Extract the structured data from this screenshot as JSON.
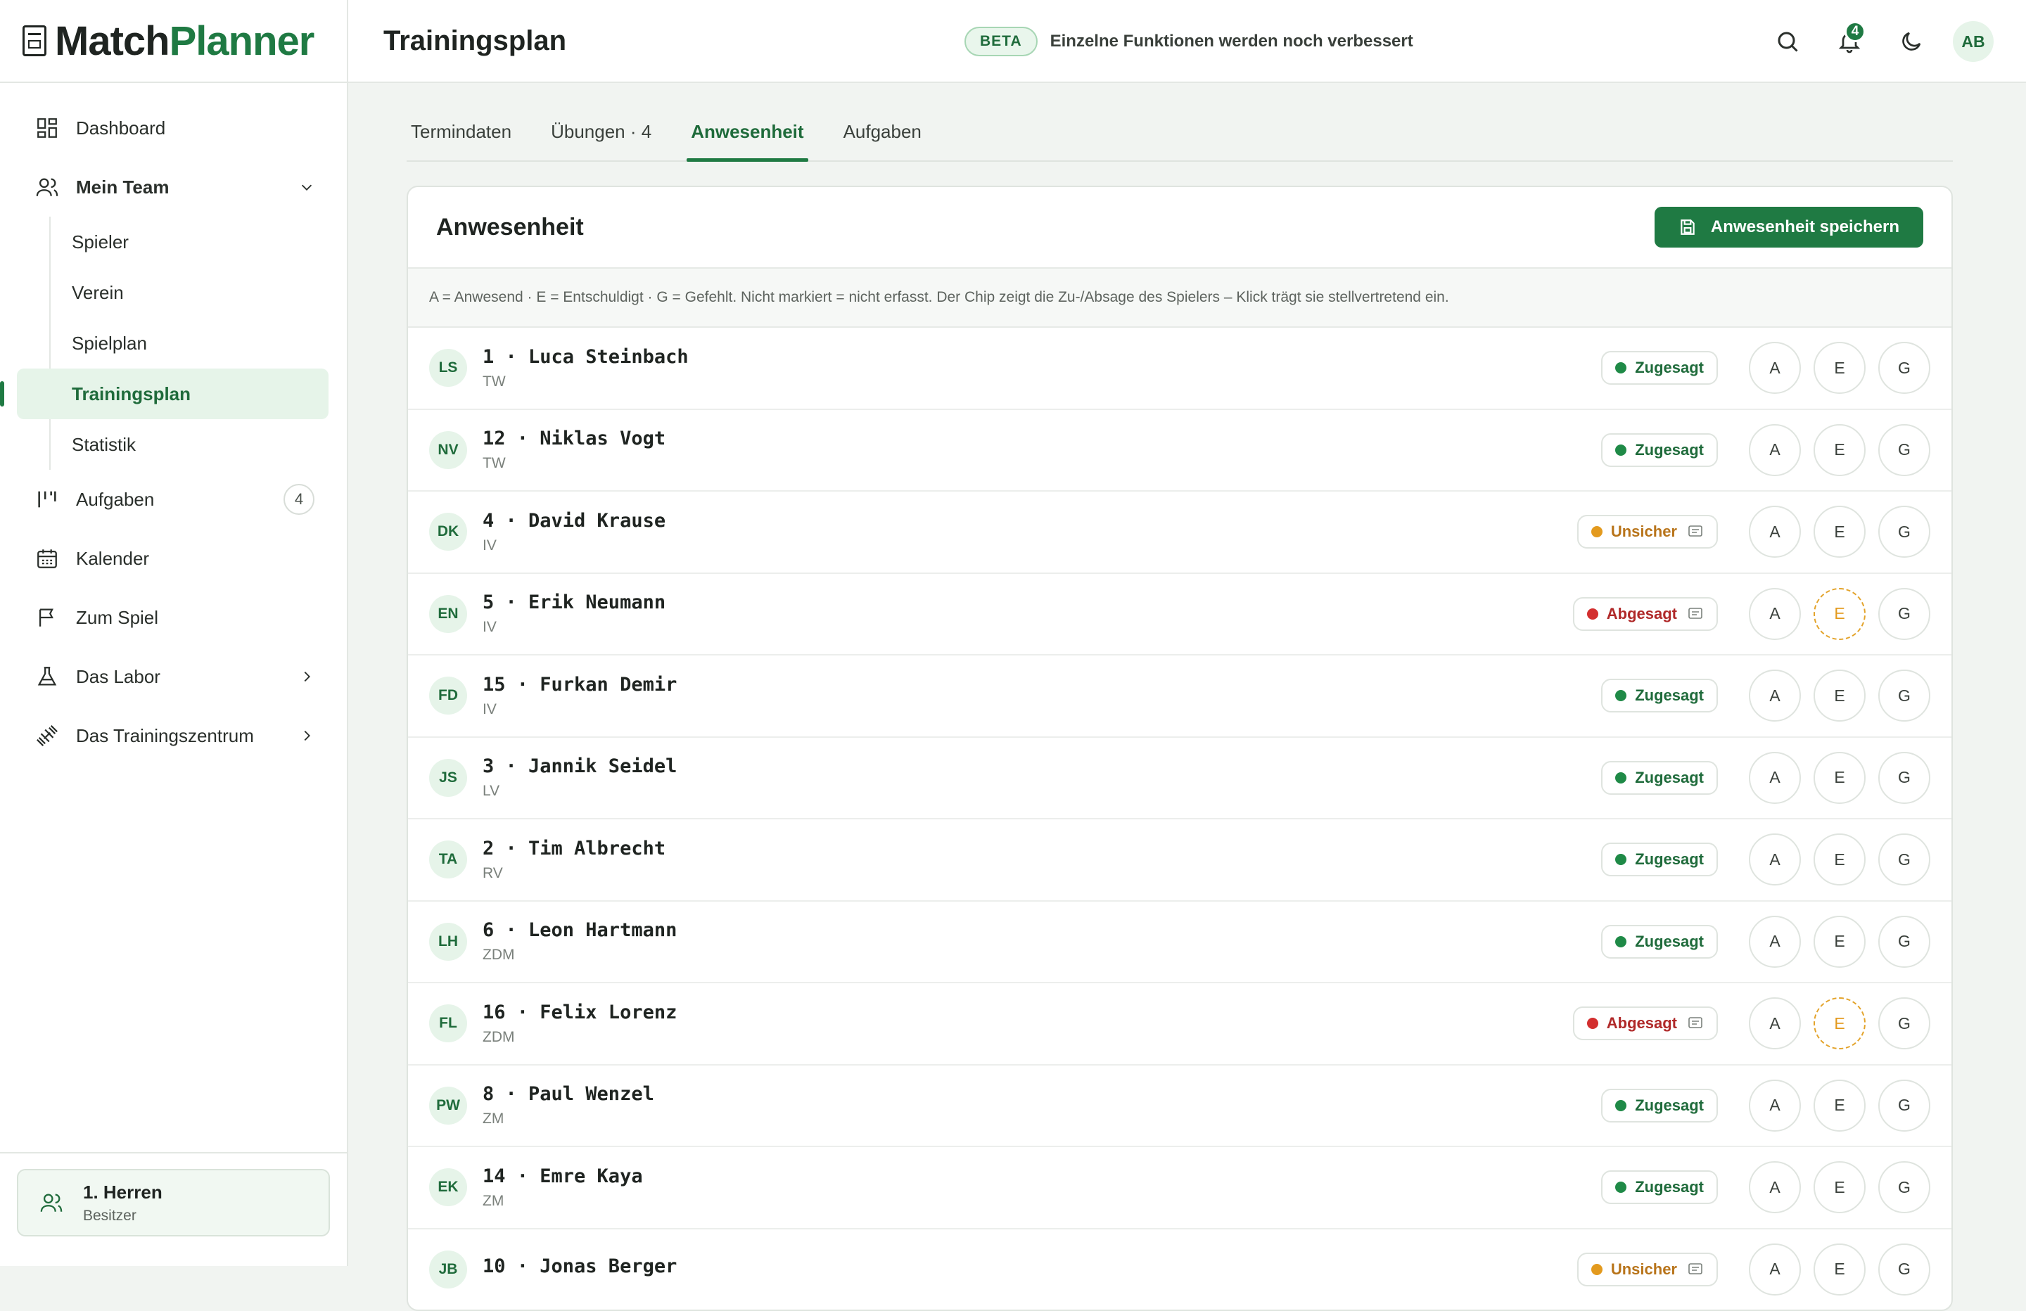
{
  "brand": {
    "part1": "Match",
    "part2": "Planner"
  },
  "nav": {
    "dashboard": "Dashboard",
    "team": "Mein Team",
    "team_sub": [
      "Spieler",
      "Verein",
      "Spielplan",
      "Trainingsplan",
      "Statistik"
    ],
    "tasks": "Aufgaben",
    "tasks_count": "4",
    "calendar": "Kalender",
    "match": "Zum Spiel",
    "lab": "Das Labor",
    "training_center": "Das Trainingszentrum"
  },
  "team_card": {
    "name": "1. Herren",
    "role": "Besitzer"
  },
  "header": {
    "title": "Trainingsplan",
    "beta": "BETA",
    "beta_text": "Einzelne Funktionen werden noch verbessert",
    "notif_count": "4",
    "avatar": "AB"
  },
  "tabs": [
    {
      "label": "Termindaten"
    },
    {
      "label": "Übungen · 4"
    },
    {
      "label": "Anwesenheit",
      "active": true
    },
    {
      "label": "Aufgaben"
    }
  ],
  "card": {
    "title": "Anwesenheit",
    "save_label": "Anwesenheit speichern",
    "hint": "A = Anwesend · E = Entschuldigt · G = Gefehlt. Nicht markiert = nicht erfasst. Der Chip zeigt die Zu-/Absage des Spielers – Klick trägt sie stellvertretend ein."
  },
  "buttons": {
    "a": "A",
    "e": "E",
    "g": "G"
  },
  "players": [
    {
      "initials": "LS",
      "name": "1 · Luca Steinbach",
      "pos": "TW",
      "status": "Zugesagt",
      "tone": "green",
      "comment": false,
      "selected": ""
    },
    {
      "initials": "NV",
      "name": "12 · Niklas Vogt",
      "pos": "TW",
      "status": "Zugesagt",
      "tone": "green",
      "comment": false,
      "selected": ""
    },
    {
      "initials": "DK",
      "name": "4 · David Krause",
      "pos": "IV",
      "status": "Unsicher",
      "tone": "amber",
      "comment": true,
      "selected": ""
    },
    {
      "initials": "EN",
      "name": "5 · Erik Neumann",
      "pos": "IV",
      "status": "Abgesagt",
      "tone": "red",
      "comment": true,
      "selected": "E"
    },
    {
      "initials": "FD",
      "name": "15 · Furkan Demir",
      "pos": "IV",
      "status": "Zugesagt",
      "tone": "green",
      "comment": false,
      "selected": ""
    },
    {
      "initials": "JS",
      "name": "3 · Jannik Seidel",
      "pos": "LV",
      "status": "Zugesagt",
      "tone": "green",
      "comment": false,
      "selected": ""
    },
    {
      "initials": "TA",
      "name": "2 · Tim Albrecht",
      "pos": "RV",
      "status": "Zugesagt",
      "tone": "green",
      "comment": false,
      "selected": ""
    },
    {
      "initials": "LH",
      "name": "6 · Leon Hartmann",
      "pos": "ZDM",
      "status": "Zugesagt",
      "tone": "green",
      "comment": false,
      "selected": ""
    },
    {
      "initials": "FL",
      "name": "16 · Felix Lorenz",
      "pos": "ZDM",
      "status": "Abgesagt",
      "tone": "red",
      "comment": true,
      "selected": "E"
    },
    {
      "initials": "PW",
      "name": "8 · Paul Wenzel",
      "pos": "ZM",
      "status": "Zugesagt",
      "tone": "green",
      "comment": false,
      "selected": ""
    },
    {
      "initials": "EK",
      "name": "14 · Emre Kaya",
      "pos": "ZM",
      "status": "Zugesagt",
      "tone": "green",
      "comment": false,
      "selected": ""
    },
    {
      "initials": "JB",
      "name": "10 · Jonas Berger",
      "pos": "",
      "status": "Unsicher",
      "tone": "amber",
      "comment": true,
      "selected": ""
    }
  ],
  "colors": {
    "accent": "#1f7a43",
    "amber": "#e39a1e",
    "red": "#d32f2f"
  }
}
